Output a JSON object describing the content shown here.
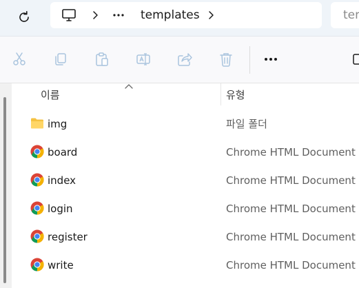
{
  "address_bar": {
    "refresh_icon": "refresh-icon",
    "computer_icon": "computer-icon",
    "overflow_label": "···",
    "current_folder": "templates",
    "search_placeholder": "tem"
  },
  "command_bar": {
    "tools": [
      {
        "name": "cut",
        "icon": "scissors-icon"
      },
      {
        "name": "copy",
        "icon": "copy-icon"
      },
      {
        "name": "paste",
        "icon": "paste-icon"
      },
      {
        "name": "rename",
        "icon": "rename-icon"
      },
      {
        "name": "share",
        "icon": "share-icon"
      },
      {
        "name": "delete",
        "icon": "trash-icon"
      }
    ],
    "more_label": "•••"
  },
  "file_list": {
    "columns": {
      "name": "이름",
      "type": "유형"
    },
    "rows": [
      {
        "name": "img",
        "type": "파일 폴더",
        "icon": "folder-icon"
      },
      {
        "name": "board",
        "type": "Chrome HTML Document",
        "icon": "chrome-icon"
      },
      {
        "name": "index",
        "type": "Chrome HTML Document",
        "icon": "chrome-icon"
      },
      {
        "name": "login",
        "type": "Chrome HTML Document",
        "icon": "chrome-icon"
      },
      {
        "name": "register",
        "type": "Chrome HTML Document",
        "icon": "chrome-icon"
      },
      {
        "name": "write",
        "type": "Chrome HTML Document",
        "icon": "chrome-icon"
      }
    ]
  },
  "colors": {
    "address_bg": "#eff4f9",
    "folder_yellow": "#f5c242",
    "text_muted": "#5f5f5f"
  }
}
